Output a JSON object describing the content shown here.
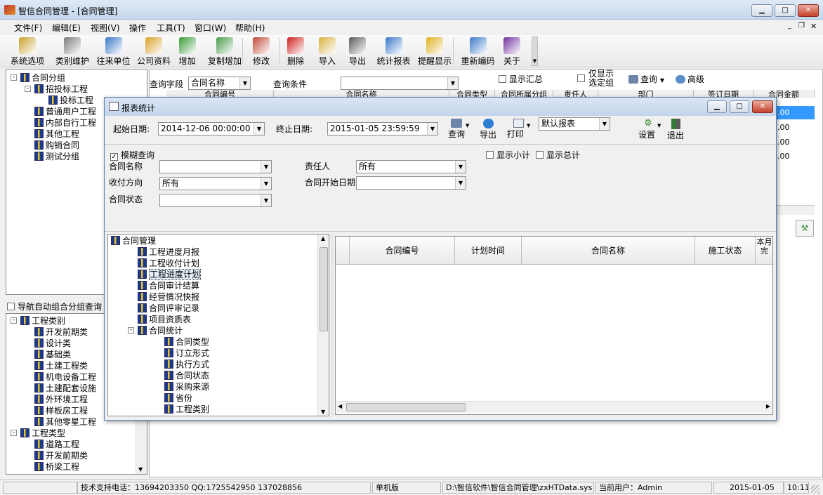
{
  "app": {
    "title": "智信合同管理 - [合同管理]"
  },
  "menu": [
    "文件(F)",
    "编辑(E)",
    "视图(V)",
    "操作",
    "工具(T)",
    "窗口(W)",
    "帮助(H)"
  ],
  "toolbar": {
    "items": [
      {
        "label": "系统选项",
        "icon": "key-icon",
        "color": "#c8a030"
      },
      {
        "label": "类别维护",
        "icon": "tools-icon",
        "color": "#7a7a7a"
      },
      {
        "label": "往来单位",
        "icon": "person-icon",
        "color": "#3a78c8"
      },
      {
        "label": "公司资料",
        "icon": "cars-icon",
        "color": "#d8a028"
      },
      {
        "label": "增加",
        "icon": "add-person-icon",
        "color": "#3a9a3a"
      },
      {
        "label": "复制增加",
        "icon": "copy-add-icon",
        "color": "#4a9a4a"
      },
      {
        "label": "修改",
        "icon": "pencil-icon",
        "color": "#c04a3a"
      },
      {
        "label": "删除",
        "icon": "delete-x-icon",
        "color": "#d02020"
      },
      {
        "label": "导入",
        "icon": "import-folder-icon",
        "color": "#d8b040"
      },
      {
        "label": "导出",
        "icon": "printer-export-icon",
        "color": "#5a5a5a"
      },
      {
        "label": "统计报表",
        "icon": "bar-chart-icon",
        "color": "#3a78c8"
      },
      {
        "label": "提醒显示",
        "icon": "warning-doc-icon",
        "color": "#e0b020"
      },
      {
        "label": "重新编码",
        "icon": "calendar-icon",
        "color": "#3a78c8"
      },
      {
        "label": "关于",
        "icon": "help-icon",
        "color": "#7030a0"
      }
    ]
  },
  "left_tree": {
    "items": [
      {
        "label": "合同分组",
        "level": 0,
        "exp": "-"
      },
      {
        "label": "招投标工程",
        "level": 1,
        "exp": "-"
      },
      {
        "label": "投标工程",
        "level": 2,
        "exp": ""
      },
      {
        "label": "普通用户工程",
        "level": 1,
        "exp": ""
      },
      {
        "label": "内部自行工程",
        "level": 1,
        "exp": ""
      },
      {
        "label": "其他工程",
        "level": 1,
        "exp": ""
      },
      {
        "label": "购销合同",
        "level": 1,
        "exp": ""
      },
      {
        "label": "测试分组",
        "level": 1,
        "exp": ""
      }
    ]
  },
  "nav_checkbox": {
    "label": "导航自动组合分组查询"
  },
  "left_tree2": {
    "items": [
      {
        "label": "工程类别",
        "level": 0,
        "exp": "-"
      },
      {
        "label": "开发前期类",
        "level": 1
      },
      {
        "label": "设计类",
        "level": 1
      },
      {
        "label": "基础类",
        "level": 1
      },
      {
        "label": "土建工程类",
        "level": 1
      },
      {
        "label": "机电设备工程",
        "level": 1
      },
      {
        "label": "土建配套设施",
        "level": 1
      },
      {
        "label": "外环境工程",
        "level": 1
      },
      {
        "label": "样板房工程",
        "level": 1
      },
      {
        "label": "其他零星工程",
        "level": 1
      },
      {
        "label": "工程类型",
        "level": 0,
        "exp": "-"
      },
      {
        "label": "道路工程",
        "level": 1
      },
      {
        "label": "开发前期类",
        "level": 1
      },
      {
        "label": "桥梁工程",
        "level": 1
      }
    ]
  },
  "main_query": {
    "field_label": "查询字段",
    "field_value": "合同名称",
    "cond_label": "查询条件",
    "show_summary": "显示汇总",
    "only_selected_1": "仅显示",
    "only_selected_2": "选定组",
    "query_btn": "查询",
    "advanced_btn": "高级"
  },
  "main_grid": {
    "headers": [
      "合同编号",
      "合同名称",
      "合同类型",
      "合同所属分组",
      "责任人",
      "部门",
      "签订日期",
      "合同金额"
    ],
    "amounts": [
      ".00",
      ".00",
      ".00",
      ".00"
    ]
  },
  "dialog": {
    "title": "报表统计",
    "start_label": "起始日期:",
    "start_value": "2014-12-06 00:00:00",
    "end_label": "终止日期:",
    "end_value": "2015-01-05 23:59:59",
    "query_btn": "查询",
    "export_btn": "导出",
    "print_btn": "打印",
    "report_value": "默认报表",
    "settings_btn": "设置",
    "exit_btn": "退出",
    "fuzzy_label": "模糊查询",
    "subtotal_label": "显示小计",
    "total_label": "显示总计",
    "f_name_label": "合同名称",
    "f_owner_label": "责任人",
    "f_owner_value": "所有",
    "f_dir_label": "收付方向",
    "f_dir_value": "所有",
    "f_start_label": "合同开始日期",
    "f_status_label": "合同状态",
    "tree": [
      {
        "label": "合同管理",
        "level": 0,
        "exp": "-"
      },
      {
        "label": "工程进度月报",
        "level": 1
      },
      {
        "label": "工程收付计划",
        "level": 1
      },
      {
        "label": "工程进度计划",
        "level": 1,
        "selected": true
      },
      {
        "label": "合同审计结算",
        "level": 1
      },
      {
        "label": "经营情况快报",
        "level": 1
      },
      {
        "label": "合同评审记录",
        "level": 1
      },
      {
        "label": "项目资质表",
        "level": 1
      },
      {
        "label": "合同统计",
        "level": 1,
        "exp": "-"
      },
      {
        "label": "合同类型",
        "level": 2
      },
      {
        "label": "订立形式",
        "level": 2
      },
      {
        "label": "执行方式",
        "level": 2
      },
      {
        "label": "合同状态",
        "level": 2
      },
      {
        "label": "采购来源",
        "level": 2
      },
      {
        "label": "省份",
        "level": 2
      },
      {
        "label": "工程类别",
        "level": 2
      }
    ],
    "grid_headers": [
      "合同编号",
      "计划时间",
      "合同名称",
      "施工状态",
      "本月完"
    ]
  },
  "status": {
    "support": "技术支持电话：13694203350 QQ:1725542950 137028856",
    "edition": "单机版",
    "path": "D:\\智信软件\\智信合同管理\\zxHTData.sys",
    "user": "当前用户：Admin",
    "date": "2015-01-05",
    "time": "10:11"
  }
}
